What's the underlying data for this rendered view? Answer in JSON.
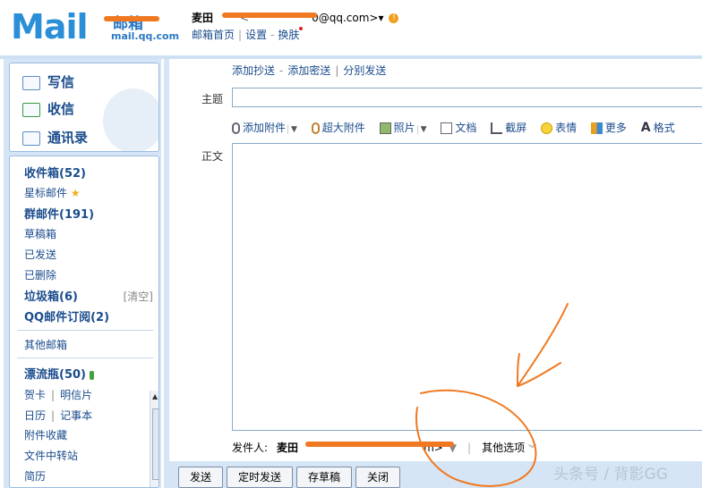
{
  "header": {
    "logo_text": "Mail",
    "logo_cn": "邮箱",
    "logo_domain": "mail.qq.com",
    "user_name": "麦田",
    "user_email_suffix": "0@qq.com>",
    "dropdown_glyph": "▾",
    "nav": [
      "邮箱首页",
      "设置",
      "换肤"
    ]
  },
  "quick": [
    {
      "label": "写信",
      "icon": "pen-icon"
    },
    {
      "label": "收信",
      "icon": "inbox-icon"
    },
    {
      "label": "通讯录",
      "icon": "contacts-icon"
    }
  ],
  "folders": {
    "inbox": "收件箱(52)",
    "starred": "星标邮件",
    "group": "群邮件(191)",
    "drafts": "草稿箱",
    "sent": "已发送",
    "deleted": "已删除",
    "spam": "垃圾箱(6)",
    "spam_clear": "[清空]",
    "subscriptions": "QQ邮件订阅(2)",
    "other": "其他邮箱",
    "drift": "漂流瓶(50)",
    "card": "贺卡",
    "postcard": "明信片",
    "calendar": "日历",
    "notes": "记事本",
    "attach": "附件收藏",
    "transfer": "文件中转站",
    "resume": "简历"
  },
  "compose": {
    "add_links": [
      "添加抄送",
      "添加密送",
      "分别发送"
    ],
    "subject_label": "主题",
    "body_label": "正文",
    "toolbar": [
      "添加附件",
      "超大附件",
      "照片",
      "文档",
      "截屏",
      "表情",
      "更多",
      "格式"
    ],
    "sender_label": "发件人:",
    "sender_name": "麦田",
    "sender_email_suffix": "m>",
    "other_options": "其他选项"
  },
  "buttons": {
    "send": "发送",
    "scheduled": "定时发送",
    "save_draft": "存草稿",
    "close": "关闭"
  },
  "watermark": "头条号 / 背影GG",
  "colors": {
    "accent": "#1a4c8c",
    "panel": "#d6e5f5",
    "annotation": "#f07820"
  }
}
